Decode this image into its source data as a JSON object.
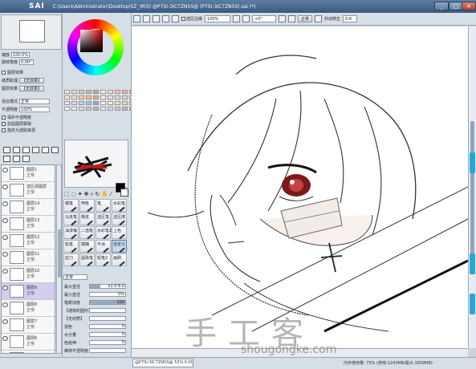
{
  "app": {
    "logo": "SAI",
    "title": "C:\\Users\\Administrator\\Desktop\\SZ_\\R(0) @P7SI-3IC7ZN5S@ (P7SI-3IC7ZN5S).sai (*)",
    "window_buttons": {
      "minimize": "_",
      "maximize": "□",
      "close": "✕"
    }
  },
  "navigator": {
    "zoom_label": "缩放",
    "zoom_value": "100.0%",
    "angle_label": "旋转角度",
    "angle_value": "0.00°"
  },
  "layer_panel": {
    "effect_label": "图层效果",
    "texture_label": "纸质肌理",
    "texture_value": "【无效果】",
    "effect2_label": "图层效果",
    "effect2_value": "【无效果】",
    "blend_label": "混合模式",
    "blend_value": "正常",
    "opacity_label": "不透明度",
    "opacity_value": "100%",
    "check_preserve": "保护不透明度",
    "check_clip": "剪贴图层蒙版",
    "check_ref": "指定为选取来源",
    "layers": [
      {
        "name": "图层1",
        "mode": "正常"
      },
      {
        "name": "选区源图层",
        "mode": "正常"
      },
      {
        "name": "图层14",
        "mode": "正常"
      },
      {
        "name": "图层13",
        "mode": "正常"
      },
      {
        "name": "图层12",
        "mode": "正常"
      },
      {
        "name": "图层11",
        "mode": "正常"
      },
      {
        "name": "图层10",
        "mode": "正常"
      },
      {
        "name": "图层9",
        "mode": "正常"
      },
      {
        "name": "图层8",
        "mode": "正常"
      },
      {
        "name": "图层7",
        "mode": "正常"
      },
      {
        "name": "图层6",
        "mode": "正常"
      },
      {
        "name": "图层5",
        "mode": "正常"
      }
    ]
  },
  "tools": {
    "grid": [
      "钢笔",
      "喷枪",
      "笔",
      "水彩笔",
      "马克笔",
      "橡皮",
      "选区笔",
      "选区擦",
      "油漆桶",
      "二值笔",
      "水彩笔2",
      "上色",
      "铅笔",
      "模糊",
      "平涂",
      "自定义",
      "剪刀",
      "圆珠笔",
      "铅笔2",
      "画刷"
    ],
    "blend_label": "正常",
    "options": [
      {
        "label": "最大直径",
        "value": "x1.0  8.0"
      },
      {
        "label": "最小直径",
        "value": "0%"
      },
      {
        "label": "笔刷浓度",
        "value": "100"
      },
      {
        "label": "【通常的圆形】",
        "value": ""
      },
      {
        "label": "【无材质】",
        "value": ""
      },
      {
        "label": "混色",
        "value": "0"
      },
      {
        "label": "水分量",
        "value": "0"
      },
      {
        "label": "色延伸",
        "value": "0"
      },
      {
        "label": "维持不透明度",
        "value": ""
      }
    ],
    "option_fill": [
      0.3,
      0.0,
      1.0,
      0.0,
      0.0,
      0.0,
      0.0,
      0.0,
      0.0
    ]
  },
  "swatches": [
    "#f6e9df",
    "#f0d7c6",
    "#e9c3a7",
    "#e2b08e",
    "#d89b7a",
    "#fff1ee",
    "#ffd9d0",
    "#ffc2b6",
    "#f7a89a",
    "#f08f82",
    "#ffeeda",
    "#ffe0bd",
    "#ffd1a0",
    "#f7be86",
    "#eaa86e",
    "#fff7ec",
    "#fde7e0",
    "#f9d5cd",
    "#ead0e7",
    "#e4c7e3",
    "#e7ecf2",
    "#d4dde9",
    "#bccde3",
    "#a7bfdd",
    "#8ea9cf",
    "#fffbe6",
    "#f5f0d8",
    "#ece4c6",
    "#e2d6b3",
    "#d1c59d",
    "#ffffff",
    "#eeeeee",
    "#dcdcdc",
    "#c8c8c8",
    "#b4b4b4",
    "#f7e6ef",
    "#e8d3e0",
    "#dcc1d2",
    "#cfaec3",
    "#c49ab5"
  ],
  "canvas_toolbar": {
    "show_selection": "选区边缘",
    "zoom": "100%",
    "angle": "+0°",
    "normal": "正常",
    "stabilizer_label": "抖动修正",
    "stabilizer_value": "S-6"
  },
  "status": {
    "doc_tab": "@P7SI-3IC7ZN5S@  53%  0.00",
    "memory": "内存使用量: 75% (使用:1243MB/最大:1659MB)"
  },
  "watermark": {
    "cn": "手工客",
    "url": "shougongke.com"
  },
  "colors": {
    "foreground": "#000000",
    "background": "#ffffff",
    "accent": "#29a6d9"
  }
}
